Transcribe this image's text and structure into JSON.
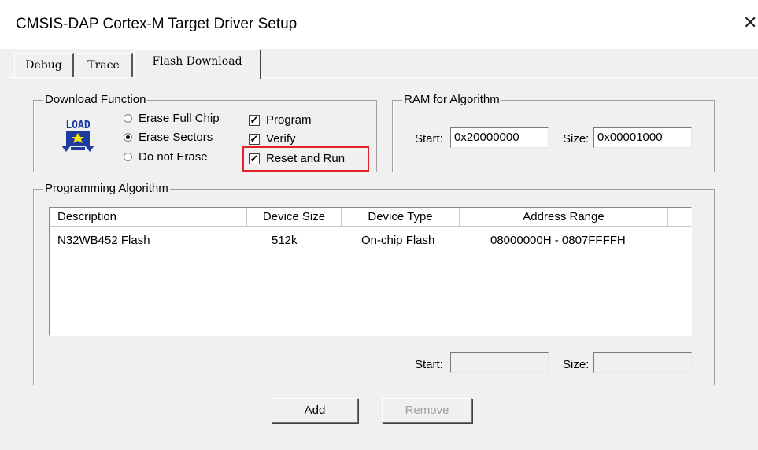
{
  "window": {
    "title": "CMSIS-DAP Cortex-M Target Driver Setup",
    "close_glyph": "✕"
  },
  "tabs": [
    {
      "label": "Debug",
      "active": false
    },
    {
      "label": "Trace",
      "active": false
    },
    {
      "label": "Flash Download",
      "active": true
    }
  ],
  "download_function": {
    "label": "Download Function",
    "icon_text": "LOAD",
    "erase_options": [
      {
        "label": "Erase Full Chip",
        "checked": false
      },
      {
        "label": "Erase Sectors",
        "checked": true
      },
      {
        "label": "Do not Erase",
        "checked": false
      }
    ],
    "checkboxes": [
      {
        "label": "Program",
        "checked": true
      },
      {
        "label": "Verify",
        "checked": true
      },
      {
        "label": "Reset and Run",
        "checked": true
      }
    ],
    "check_glyph": "✓"
  },
  "ram": {
    "label": "RAM for Algorithm",
    "start_label": "Start:",
    "start_value": "0x20000000",
    "size_label": "Size:",
    "size_value": "0x00001000"
  },
  "programming": {
    "label": "Programming Algorithm",
    "columns": [
      "Description",
      "Device Size",
      "Device Type",
      "Address Range"
    ],
    "rows": [
      [
        "N32WB452 Flash",
        "512k",
        "On-chip Flash",
        "08000000H - 0807FFFFH"
      ]
    ],
    "start_label": "Start:",
    "start_value": "",
    "size_label": "Size:",
    "size_value": ""
  },
  "buttons": {
    "add": "Add",
    "remove": "Remove"
  },
  "colors": {
    "highlight": "#e0202a",
    "icon_blue": "#1c3aa0",
    "icon_yellow": "#f4e900"
  }
}
